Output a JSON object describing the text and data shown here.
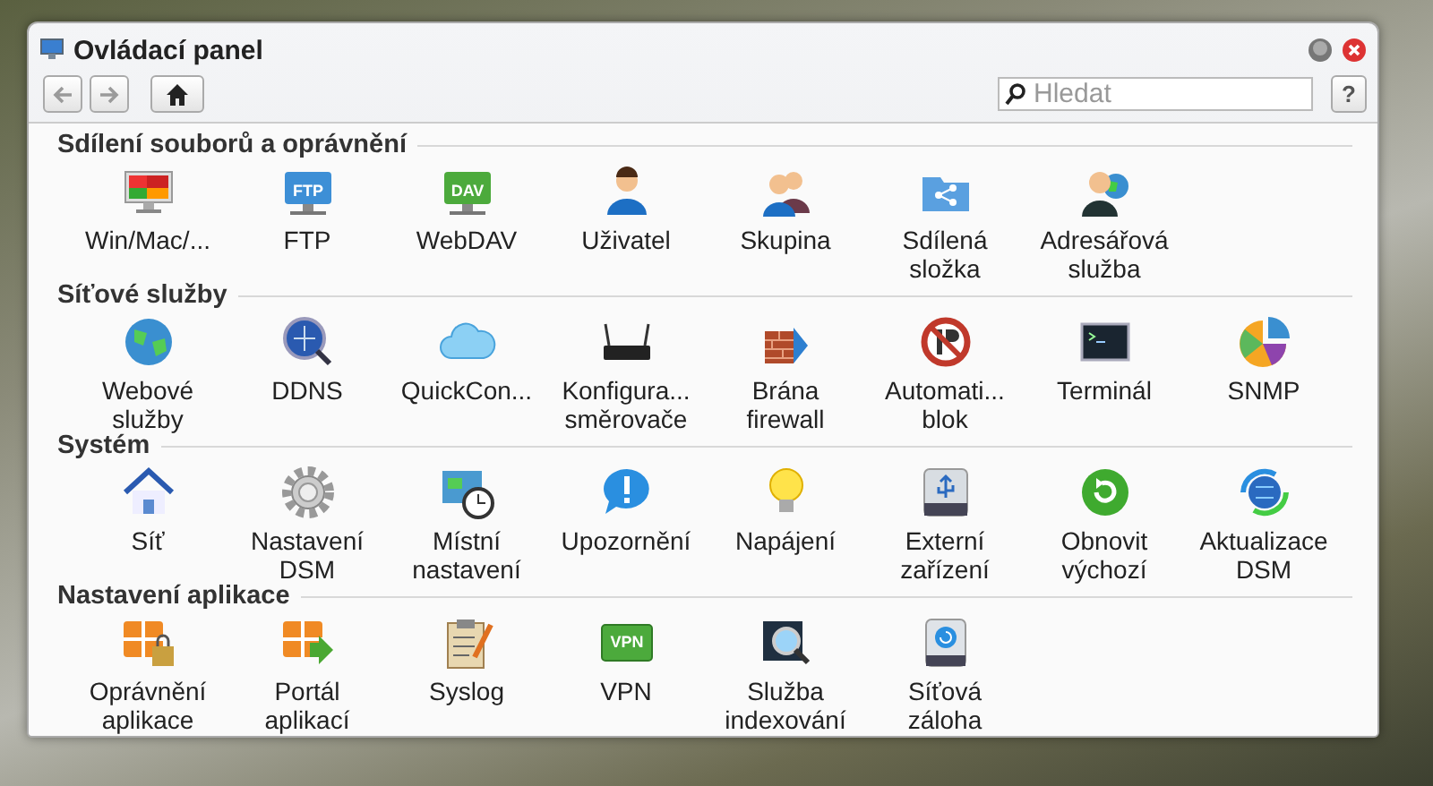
{
  "window": {
    "title": "Ovládací panel"
  },
  "toolbar": {
    "back": {
      "disabled": true
    },
    "forward": {
      "disabled": true
    },
    "search": {
      "placeholder": "Hledat"
    },
    "help": "?"
  },
  "sections": [
    {
      "title": "Sdílení souborů a oprávnění",
      "items": [
        {
          "label": "Win/Mac/..."
        },
        {
          "label": "FTP",
          "icon_text": "FTP"
        },
        {
          "label": "WebDAV",
          "icon_text": "DAV"
        },
        {
          "label": "Uživatel"
        },
        {
          "label": "Skupina"
        },
        {
          "label": "Sdílená\nsložka"
        },
        {
          "label": "Adresářová\nslužba"
        }
      ]
    },
    {
      "title": "Síťové služby",
      "items": [
        {
          "label": "Webové\nslužby"
        },
        {
          "label": "DDNS"
        },
        {
          "label": "QuickCon..."
        },
        {
          "label": "Konfigura...\nsměrovače"
        },
        {
          "label": "Brána\nfirewall"
        },
        {
          "label": "Automati...\nblok"
        },
        {
          "label": "Terminál"
        },
        {
          "label": "SNMP"
        }
      ]
    },
    {
      "title": "Systém",
      "items": [
        {
          "label": "Síť"
        },
        {
          "label": "Nastavení\nDSM"
        },
        {
          "label": "Místní\nnastavení"
        },
        {
          "label": "Upozornění"
        },
        {
          "label": "Napájení"
        },
        {
          "label": "Externí\nzařízení"
        },
        {
          "label": "Obnovit\nvýchozí"
        },
        {
          "label": "Aktualizace\nDSM"
        }
      ]
    },
    {
      "title": "Nastavení aplikace",
      "items": [
        {
          "label": "Oprávnění\naplikace"
        },
        {
          "label": "Portál\naplikací"
        },
        {
          "label": "Syslog"
        },
        {
          "label": "VPN",
          "icon_text": "VPN"
        },
        {
          "label": "Služba\nindexování"
        },
        {
          "label": "Síťová\nzáloha"
        }
      ]
    }
  ]
}
